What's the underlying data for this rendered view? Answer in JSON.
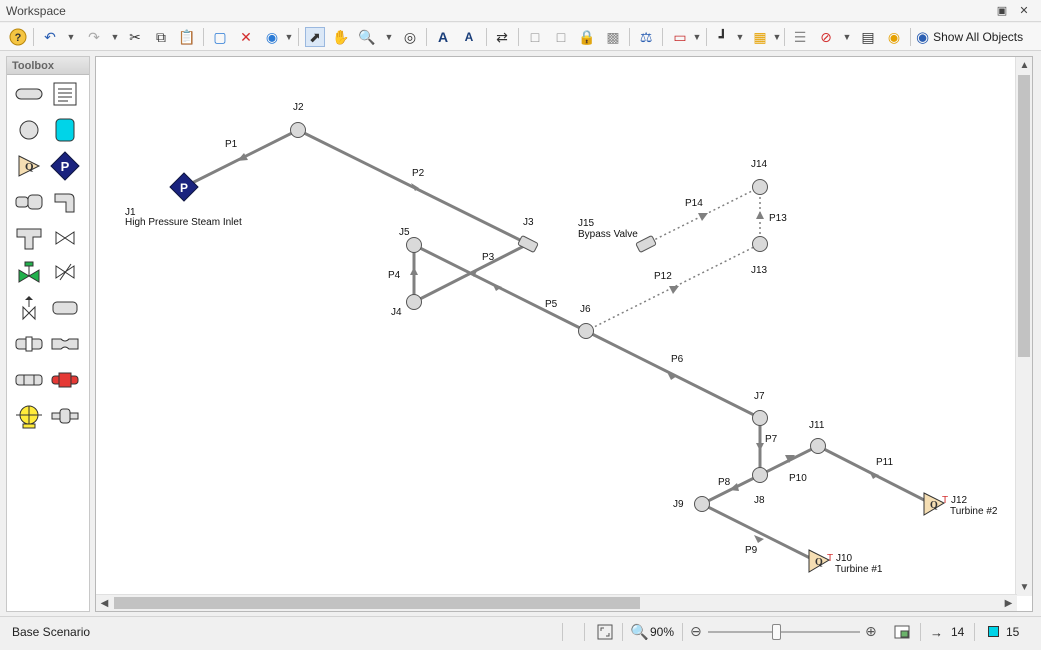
{
  "window": {
    "title": "Workspace"
  },
  "toolbar": {
    "show_all_label": "Show All Objects"
  },
  "toolbox": {
    "title": "Toolbox"
  },
  "diagram": {
    "junctions": [
      {
        "id": "J1",
        "label": "J1",
        "desc": "High Pressure Steam Inlet"
      },
      {
        "id": "J2",
        "label": "J2"
      },
      {
        "id": "J3",
        "label": "J3"
      },
      {
        "id": "J4",
        "label": "J4"
      },
      {
        "id": "J5",
        "label": "J5"
      },
      {
        "id": "J6",
        "label": "J6"
      },
      {
        "id": "J7",
        "label": "J7"
      },
      {
        "id": "J8",
        "label": "J8"
      },
      {
        "id": "J9",
        "label": "J9"
      },
      {
        "id": "J10",
        "label": "J10",
        "desc": "Turbine #1"
      },
      {
        "id": "J11",
        "label": "J11"
      },
      {
        "id": "J12",
        "label": "J12",
        "desc": "Turbine #2"
      },
      {
        "id": "J13",
        "label": "J13"
      },
      {
        "id": "J14",
        "label": "J14"
      },
      {
        "id": "J15",
        "label": "J15",
        "desc": "Bypass Valve"
      }
    ],
    "pipes": [
      "P1",
      "P2",
      "P3",
      "P4",
      "P5",
      "P6",
      "P7",
      "P8",
      "P9",
      "P10",
      "P11",
      "P12",
      "P13",
      "P14"
    ],
    "turbine_marker": "T",
    "pressure_symbol": "P",
    "flow_symbol": "Q"
  },
  "status": {
    "scenario": "Base Scenario",
    "zoom": "90%",
    "pipe_count": "14",
    "junction_count": "15"
  },
  "colors": {
    "pipe": "#808080",
    "accent": "#1a237e",
    "boundary_fill": "#f5deb3"
  }
}
